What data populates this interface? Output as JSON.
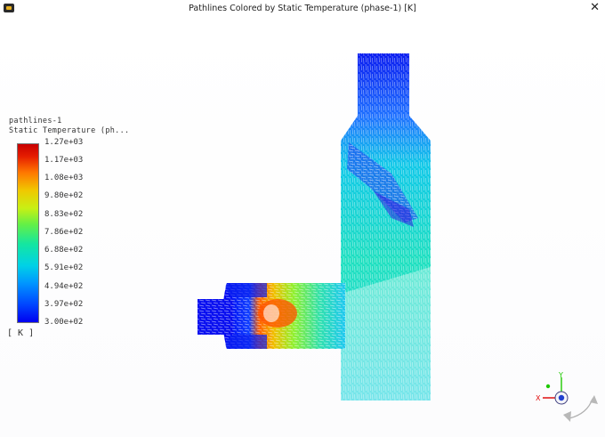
{
  "window": {
    "title": "Pathlines Colored by Static Temperature (phase-1)  [K]",
    "close_glyph": "✕"
  },
  "legend": {
    "name": "pathlines-1",
    "field": "Static Temperature (ph...",
    "unit": "[ K ]",
    "ticks": [
      "1.27e+03",
      "1.17e+03",
      "1.08e+03",
      "9.80e+02",
      "8.83e+02",
      "7.86e+02",
      "6.88e+02",
      "5.91e+02",
      "4.94e+02",
      "3.97e+02",
      "3.00e+02"
    ]
  },
  "triad": {
    "y_label": "Y",
    "x_label": "X",
    "colors": {
      "y": "#1ec800",
      "x": "#e01010",
      "z": "#2040d0"
    }
  },
  "colors": {
    "cold": "#0000f0",
    "mid": "#20e0c0",
    "hot": "#ff5000"
  }
}
